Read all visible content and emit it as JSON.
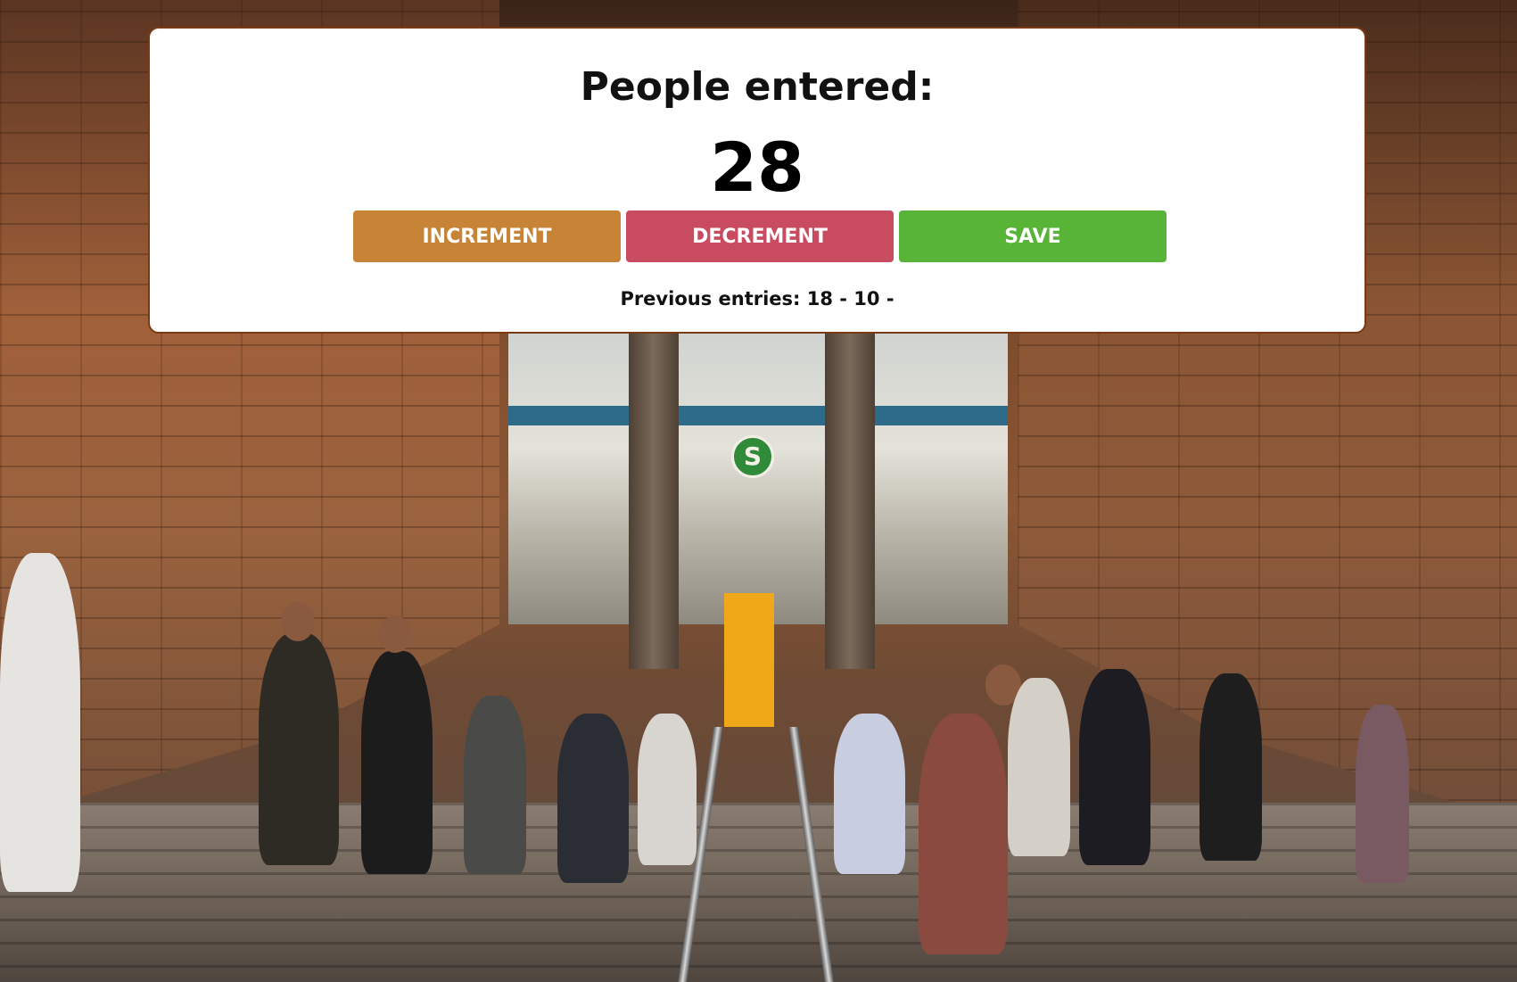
{
  "counter": {
    "title": "People entered:",
    "count": "28",
    "previous_label": "Previous entries:",
    "previous_entries": [
      "18",
      "10"
    ],
    "previous_text": "Previous entries: 18 - 10 -"
  },
  "buttons": {
    "increment": {
      "label": "INCREMENT",
      "color": "#c88436"
    },
    "decrement": {
      "label": "DECREMENT",
      "color": "#c84b60"
    },
    "save": {
      "label": "SAVE",
      "color": "#58b436"
    }
  },
  "colors": {
    "card_background": "#ffffff",
    "card_border": "#7a3b14"
  },
  "background": {
    "icon": "subway-station-photo",
    "sign_text": "S"
  }
}
